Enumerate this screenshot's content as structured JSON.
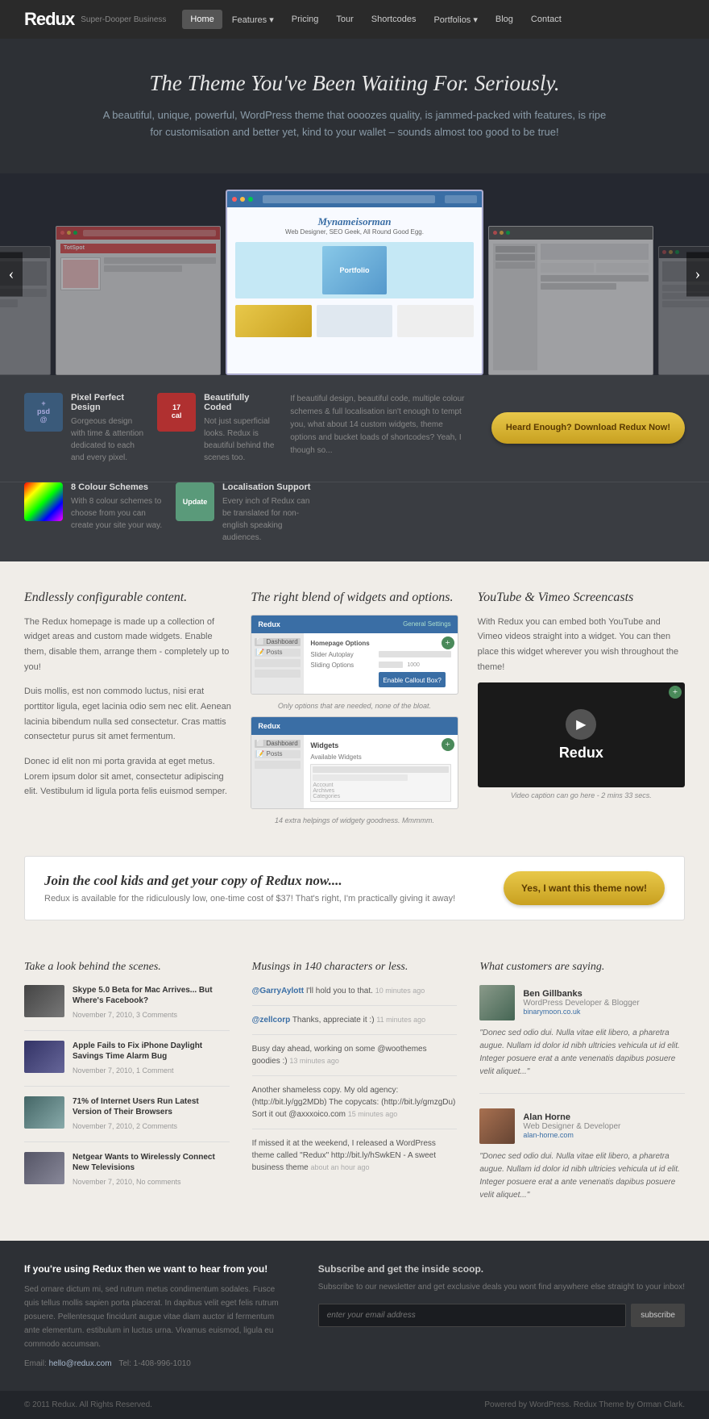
{
  "nav": {
    "logo": "Redux",
    "logo_sub": "Super-Dooper Business",
    "items": [
      {
        "label": "Home",
        "active": true,
        "has_arrow": false
      },
      {
        "label": "Features",
        "active": false,
        "has_arrow": true
      },
      {
        "label": "Pricing",
        "active": false,
        "has_arrow": false
      },
      {
        "label": "Tour",
        "active": false,
        "has_arrow": false
      },
      {
        "label": "Shortcodes",
        "active": false,
        "has_arrow": false
      },
      {
        "label": "Portfolios",
        "active": false,
        "has_arrow": true
      },
      {
        "label": "Blog",
        "active": false,
        "has_arrow": false
      },
      {
        "label": "Contact",
        "active": false,
        "has_arrow": false
      }
    ]
  },
  "hero": {
    "title": "The Theme You've Been Waiting For. Seriously.",
    "subtitle": "A beautiful, unique, powerful, WordPress theme that oooozes quality, is jammed-packed with features, is ripe for customisation and better yet, kind to your wallet – sounds almost too good to be true!"
  },
  "slider": {
    "left_arrow": "‹",
    "right_arrow": "›",
    "main_screen_name": "Mynameisorman",
    "main_screen_tagline": "Web Designer, SEO Geek, All Round Good Egg."
  },
  "features": [
    {
      "icon": "psd",
      "title": "Pixel Perfect Design",
      "text": "Gorgeous design with time & attention dedicated to each and every pixel."
    },
    {
      "icon": "code",
      "title": "Beautifully Coded",
      "text": "Not just superficial looks. Redux is beautiful behind the scenes too."
    },
    {
      "icon": "colors",
      "title": "8 Colour Schemes",
      "text": "With 8 colour schemes to choose from you can create your site your way."
    },
    {
      "icon": "update",
      "title": "Localisation Support",
      "text": "Every inch of Redux can be translated for non-english speaking audiences."
    }
  ],
  "features_cta": {
    "long_text": "If beautiful design, beautiful code, multiple colour schemes & full localisation isn't enough to tempt you, what about 14 custom widgets, theme options and bucket loads of shortcodes? Yeah, I though so...",
    "button": "Heard Enough? Download Redux Now!"
  },
  "sections": {
    "configurable": {
      "title": "Endlessly configurable content.",
      "paragraphs": [
        "The Redux homepage is made up a collection of widget areas and custom made widgets. Enable them, disable them, arrange them - completely up to you!",
        "Duis mollis, est non commodo luctus, nisi erat porttitor ligula, eget lacinia odio sem nec elit. Aenean lacinia bibendum nulla sed consectetur. Cras mattis consectetur purus sit amet fermentum.",
        "Donec id elit non mi porta gravida at eget metus. Lorem ipsum dolor sit amet, consectetur adipiscing elit. Vestibulum id ligula porta felis euismod semper."
      ]
    },
    "widgets": {
      "title": "The right blend of widgets and options.",
      "caption1": "Only options that are needed, none of the bloat.",
      "caption2": "14 extra helpings of widgety goodness. Mmmmm."
    },
    "video": {
      "title": "YouTube & Vimeo Screencasts",
      "text": "With Redux you can embed both YouTube and Vimeo videos straight into a widget. You can then place this widget wherever you wish throughout the theme!",
      "video_title": "Redux",
      "caption": "Video caption can go here - 2 mins 33 secs."
    }
  },
  "join": {
    "title": "Join the cool kids and get your copy of Redux now....",
    "text": "Redux is available for the ridiculously low, one-time cost of $37! That's right, I'm practically giving it away!",
    "button": "Yes, I want this theme now!"
  },
  "blog": {
    "title": "Take a look behind the scenes.",
    "posts": [
      {
        "title": "Skype 5.0 Beta for Mac Arrives... But Where's Facebook?",
        "meta": "November 7, 2010, 3 Comments"
      },
      {
        "title": "Apple Fails to Fix iPhone Daylight Savings Time Alarm Bug",
        "meta": "November 7, 2010, 1 Comment"
      },
      {
        "title": "71% of Internet Users Run Latest Version of Their Browsers",
        "meta": "November 7, 2010, 2 Comments"
      },
      {
        "title": "Netgear Wants to Wirelessly Connect New Televisions",
        "meta": "November 7, 2010, No comments"
      }
    ]
  },
  "tweets": {
    "title": "Musings in 140 characters or less.",
    "items": [
      {
        "handle": "@GarryAylott",
        "text": " I'll hold you to that.",
        "time": "10 minutes ago"
      },
      {
        "handle": "@zellcorp",
        "text": " Thanks, appreciate it :)",
        "time": "11 minutes ago"
      },
      {
        "handle": "",
        "text": "Busy day ahead, working on some @woothemes goodies :)",
        "time": "13 minutes ago"
      },
      {
        "handle": "",
        "text": "Another shameless copy. My old agency: (http://bit.ly/gg2MDb) The copycats: (http://bit.ly/gmzgDu) Sort it out @axxxoico.com",
        "time": "15 minutes ago"
      },
      {
        "handle": "",
        "text": "If missed it at the weekend, I released a WordPress theme called \"Redux\" http://bit.ly/hSwkEN - A sweet business theme",
        "time": "about an hour ago"
      }
    ]
  },
  "testimonials": {
    "title": "What customers are saying.",
    "items": [
      {
        "name": "Ben Gillbanks",
        "role": "WordPress Developer & Blogger",
        "site": "binarymoon.co.uk",
        "quote": "\"Donec sed odio dui. Nulla vitae elit libero, a pharetra augue. Nullam id dolor id nibh ultricies vehicula ut id elit. Integer posuere erat a ante venenatis dapibus posuere velit aliquet...\""
      },
      {
        "name": "Alan Horne",
        "role": "Web Designer & Developer",
        "site": "alan-horne.com",
        "quote": "\"Donec sed odio dui. Nulla vitae elit libero, a pharetra augue. Nullam id dolor id nibh ultricies vehicula ut id elit. Integer posuere erat a ante venenatis dapibus posuere velit aliquet...\""
      }
    ]
  },
  "footer": {
    "contact_title": "If you're using Redux then we want to hear from you!",
    "contact_text": "Sed ornare dictum mi, sed rutrum metus condimentum sodales. Fusce quis tellus mollis sapien porta placerat. In dapibus velit eget felis rutrum posuere. Pellentesque fincidunt augue vitae diam auctor id fermentum ante elementum. estibulum in luctus urna. Vivamus euismod, ligula eu commodo accumsan.",
    "email_label": "Email:",
    "email": "hello@redux.com",
    "tel_label": "Tel:",
    "tel": "1-408-996-1010",
    "subscribe_title": "Subscribe and get the inside scoop.",
    "subscribe_text": "Subscribe to our newsletter and get exclusive deals you wont find anywhere else straight to your inbox!",
    "subscribe_placeholder": "enter your email address",
    "subscribe_button": "subscribe"
  },
  "footer_bottom": {
    "copy": "© 2011 Redux. All Rights Reserved.",
    "credit": "Powered by WordPress. Redux Theme by Orman Clark."
  }
}
